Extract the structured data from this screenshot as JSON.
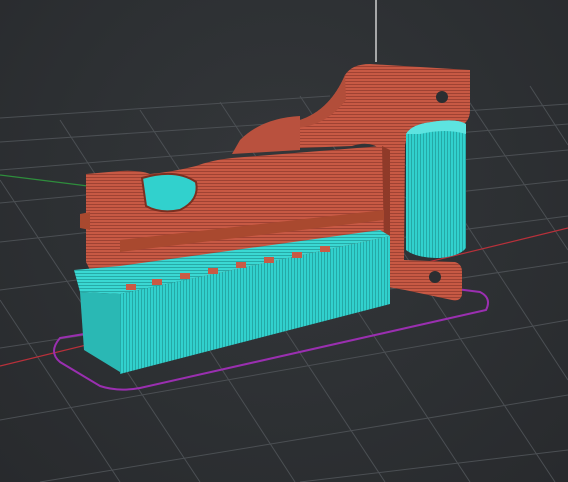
{
  "viewport": {
    "kind": "3d-preview",
    "objects": [
      {
        "name": "bracket",
        "color": "#c95a45"
      },
      {
        "name": "box",
        "color": "#2fd3cf"
      },
      {
        "name": "grip",
        "color": "#34cfd0"
      }
    ],
    "plate_outline_color": "#9a2fb0",
    "axis_x_color": "#b8303a",
    "axis_y_color": "#2e8d3c",
    "axis_z_color": "#cfcfcf"
  }
}
